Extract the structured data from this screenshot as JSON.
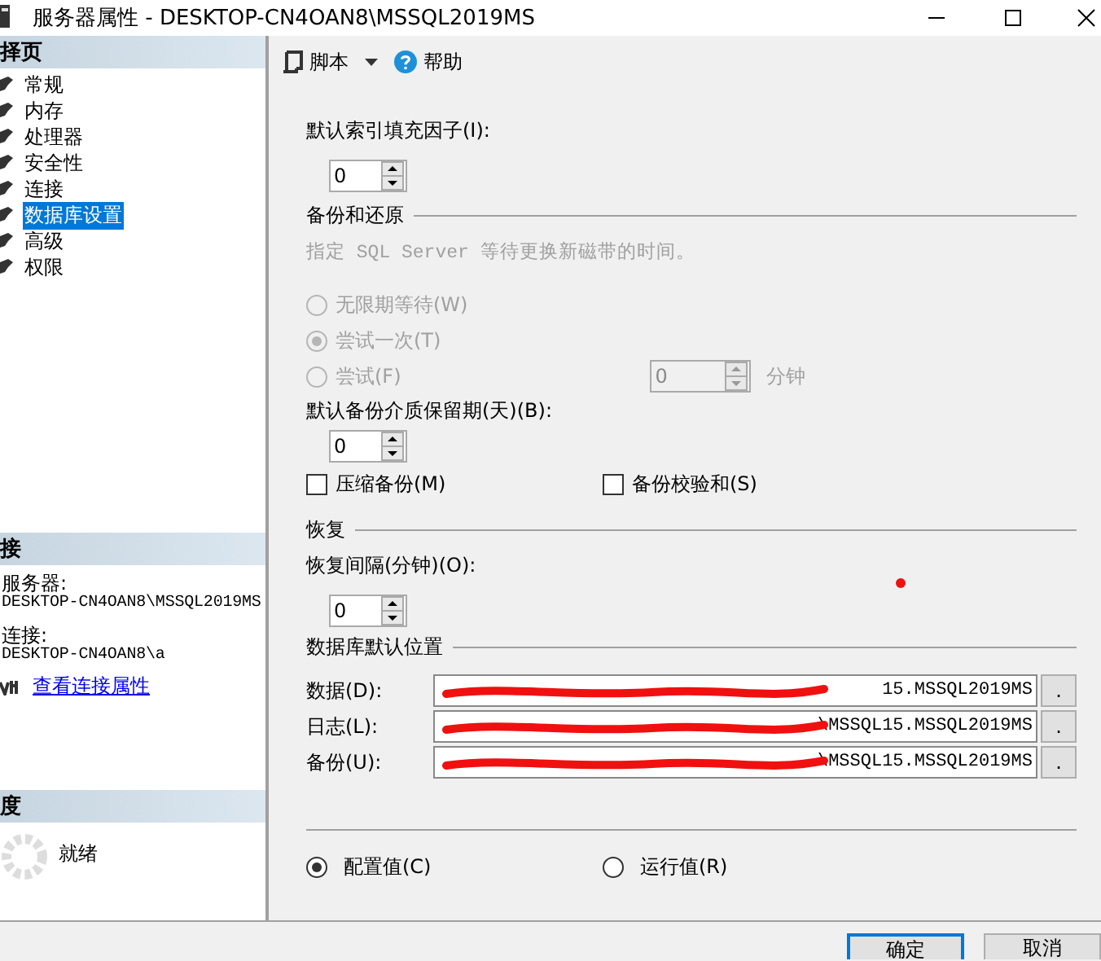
{
  "window": {
    "title": "服务器属性 - DESKTOP-CN4OAN8\\MSSQL2019MS"
  },
  "sidebar": {
    "select_header": "择页",
    "pages": [
      {
        "label": "常规",
        "selected": false
      },
      {
        "label": "内存",
        "selected": false
      },
      {
        "label": "处理器",
        "selected": false
      },
      {
        "label": "安全性",
        "selected": false
      },
      {
        "label": "连接",
        "selected": false
      },
      {
        "label": "数据库设置",
        "selected": true
      },
      {
        "label": "高级",
        "selected": false
      },
      {
        "label": "权限",
        "selected": false
      }
    ],
    "connection": {
      "header": "接",
      "server_label": "服务器:",
      "server": "DESKTOP-CN4OAN8\\MSSQL2019MS",
      "connection_label": "连接:",
      "connection": "DESKTOP-CN4OAN8\\a",
      "link": "查看连接属性"
    },
    "progress": {
      "header": "度",
      "status": "就绪"
    }
  },
  "toolbar": {
    "script": "脚本",
    "help": "帮助"
  },
  "fill_factor": {
    "label": "默认索引填充因子(I):",
    "value": "0"
  },
  "backup_restore": {
    "title": "备份和还原",
    "hint": "指定 SQL Server 等待更换新磁带的时间。",
    "disabled": true,
    "wait_options": [
      {
        "label": "无限期等待(W)",
        "selected": false
      },
      {
        "label": "尝试一次(T)",
        "selected": true
      },
      {
        "label": "尝试(F)",
        "selected": false
      }
    ],
    "try_minutes": "0",
    "minutes_unit": "分钟",
    "retention_label": "默认备份介质保留期(天)(B):",
    "retention": "0",
    "checkboxes": [
      {
        "label": "压缩备份(M)",
        "checked": false
      },
      {
        "label": "备份校验和(S)",
        "checked": false
      }
    ]
  },
  "recovery": {
    "title": "恢复",
    "interval_label": "恢复间隔(分钟)(O):",
    "interval": "0"
  },
  "default_locations": {
    "title": "数据库默认位置",
    "paths": [
      {
        "label": "数据(D):",
        "value": "15.MSSQL2019MS",
        "browse": "."
      },
      {
        "label": "日志(L):",
        "value": "\\MSSQL15.MSSQL2019MS",
        "browse": "."
      },
      {
        "label": "备份(U):",
        "value": "\\MSSQL15.MSSQL2019MS",
        "browse": "."
      }
    ]
  },
  "value_mode": [
    {
      "label": "配置值(C)",
      "selected": true
    },
    {
      "label": "运行值(R)",
      "selected": false
    }
  ],
  "buttons": [
    {
      "label": "确定",
      "default": true
    },
    {
      "label": "取消",
      "default": false
    }
  ]
}
